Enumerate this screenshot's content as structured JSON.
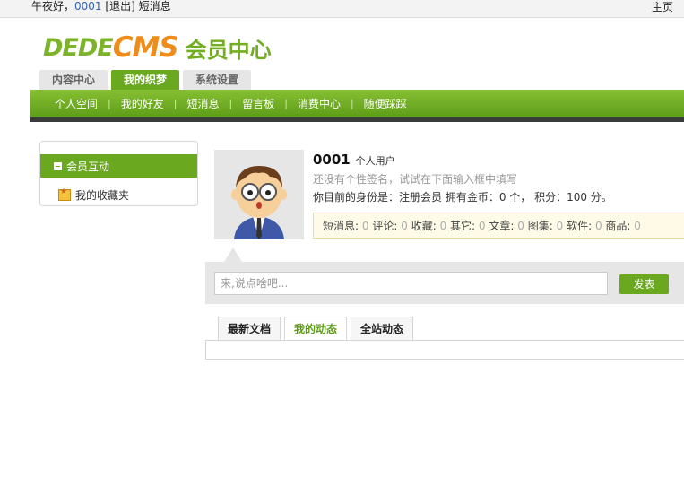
{
  "topbar": {
    "greeting": "午夜好，",
    "user_link": "0001",
    "logout": "[退出]",
    "messages": "短消息",
    "home": "主页"
  },
  "logo": {
    "dede": "DEDE",
    "cms": "CMS",
    "member_center": "会员中心"
  },
  "tabs": [
    {
      "label": "内容中心",
      "active": false
    },
    {
      "label": "我的织梦",
      "active": true
    },
    {
      "label": "系统设置",
      "active": false
    }
  ],
  "nav": [
    "个人空间",
    "我的好友",
    "短消息",
    "留言板",
    "消费中心",
    "随便踩踩"
  ],
  "sidebar": {
    "section": "会员互动",
    "items": [
      "我的收藏夹"
    ]
  },
  "profile": {
    "username": "0001",
    "user_type": "个人用户",
    "signature": "还没有个性签名，试试在下面输入框中填写",
    "status": "你目前的身份是：注册会员 拥有金币：0 个， 积分：100 分。"
  },
  "stats": [
    {
      "label": "短消息:",
      "value": "0"
    },
    {
      "label": "评论:",
      "value": "0"
    },
    {
      "label": "收藏:",
      "value": "0"
    },
    {
      "label": "其它:",
      "value": "0"
    },
    {
      "label": "文章:",
      "value": "0"
    },
    {
      "label": "图集:",
      "value": "0"
    },
    {
      "label": "软件:",
      "value": "0"
    },
    {
      "label": "商品:",
      "value": "0"
    }
  ],
  "post": {
    "placeholder": "来,说点啥吧...",
    "button": "发表"
  },
  "feed_tabs": [
    {
      "label": "最新文档",
      "active": false
    },
    {
      "label": "我的动态",
      "active": true
    },
    {
      "label": "全站动态",
      "active": false
    }
  ],
  "colors": {
    "accent_green": "#6aa820",
    "logo_orange": "#f08c1a",
    "link_blue": "#3464b4"
  }
}
